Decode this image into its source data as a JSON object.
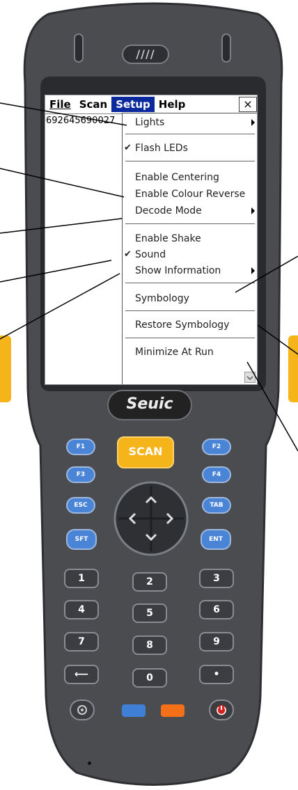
{
  "device": {
    "brand": "Seuic",
    "speaker_label": "////"
  },
  "menubar": {
    "items": [
      "File",
      "Scan",
      "Setup",
      "Help"
    ],
    "active": "Setup",
    "close_label": "×"
  },
  "scan_value": "692645690027",
  "dropdown": {
    "items": [
      {
        "label": "Lights",
        "checked": false,
        "submenu": true
      },
      {
        "label": "Flash LEDs",
        "checked": true,
        "submenu": false
      },
      {
        "label": "Enable Centering",
        "checked": false,
        "submenu": false
      },
      {
        "label": "Enable Colour Reverse",
        "checked": false,
        "submenu": false
      },
      {
        "label": "Decode Mode",
        "checked": false,
        "submenu": true
      },
      {
        "label": "Enable Shake",
        "checked": false,
        "submenu": false
      },
      {
        "label": "Sound",
        "checked": true,
        "submenu": false
      },
      {
        "label": "Show Information",
        "checked": false,
        "submenu": true
      },
      {
        "label": "Symbology",
        "checked": false,
        "submenu": false
      },
      {
        "label": "Restore Symbology",
        "checked": false,
        "submenu": false
      },
      {
        "label": "Minimize At Run",
        "checked": false,
        "submenu": false
      }
    ],
    "check_mark": "✔"
  },
  "keys": {
    "scan": "SCAN",
    "f1": "F1",
    "f2": "F2",
    "f3": "F3",
    "f4": "F4",
    "esc": "ESC",
    "tab": "TAB",
    "sft": "SFT",
    "ent": "ENT",
    "num1": "1",
    "num2": "2",
    "num3": "3",
    "num4": "4",
    "num5": "5",
    "num6": "6",
    "num7": "7",
    "num8": "8",
    "num9": "9",
    "back": "⟵",
    "num0": "0",
    "dot": "•"
  },
  "colors": {
    "body": "#4a4c50",
    "side_accent": "#f5b51a",
    "menu_highlight": "#0a2a9e",
    "fkey": "#4a84d6",
    "blue_button": "#3f7fd6",
    "orange_button": "#f36f18",
    "power_button": "#d61f1f"
  }
}
